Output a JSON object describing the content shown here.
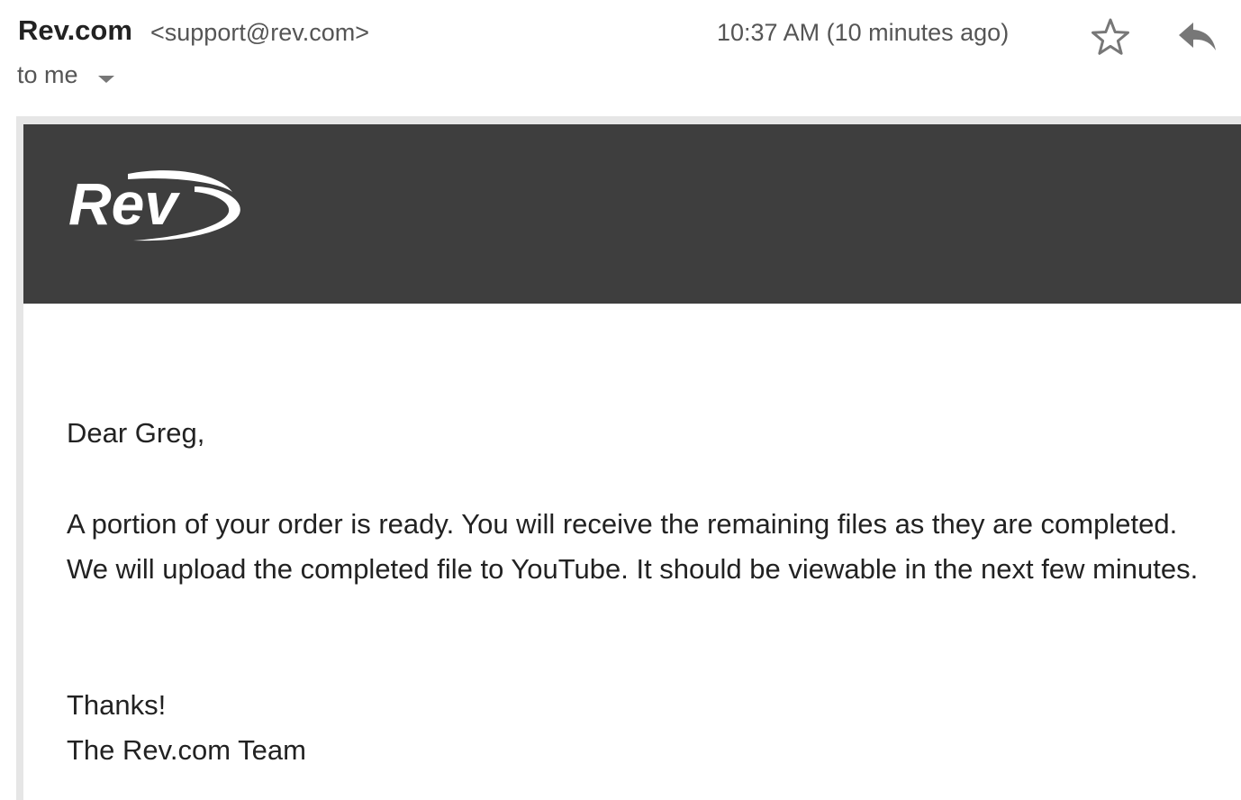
{
  "header": {
    "sender_name": "Rev.com",
    "sender_email": "<support@rev.com>",
    "timestamp": "10:37 AM (10 minutes ago)",
    "recipient": "to me"
  },
  "email": {
    "logo_text": "Rev",
    "greeting": "Dear Greg,",
    "message": "A portion of your order is ready. You will receive the remaining files as they are completed. We will upload the completed file to YouTube. It should be viewable in the next few minutes.",
    "thanks": "Thanks!",
    "signature": "The Rev.com Team"
  },
  "icons": {
    "star": "star-icon",
    "reply": "reply-icon",
    "caret": "chevron-down-icon"
  },
  "colors": {
    "banner": "#3e3e3e",
    "icon": "#777777"
  }
}
